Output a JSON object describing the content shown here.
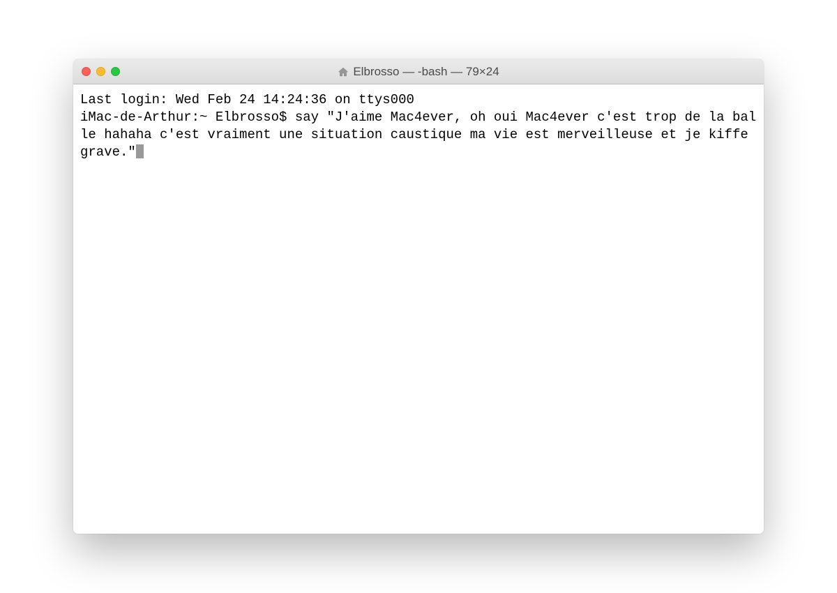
{
  "window": {
    "title": "Elbrosso — -bash — 79×24"
  },
  "terminal": {
    "lastLogin": "Last login: Wed Feb 24 14:24:36 on ttys000",
    "promptHost": "iMac-de-Arthur:~ Elbrosso$ ",
    "command": "say \"J'aime Mac4ever, oh oui Mac4ever c'est trop de la balle hahaha c'est vraiment une situation caustique ma vie est merveilleuse et je kiffe grave.\""
  }
}
